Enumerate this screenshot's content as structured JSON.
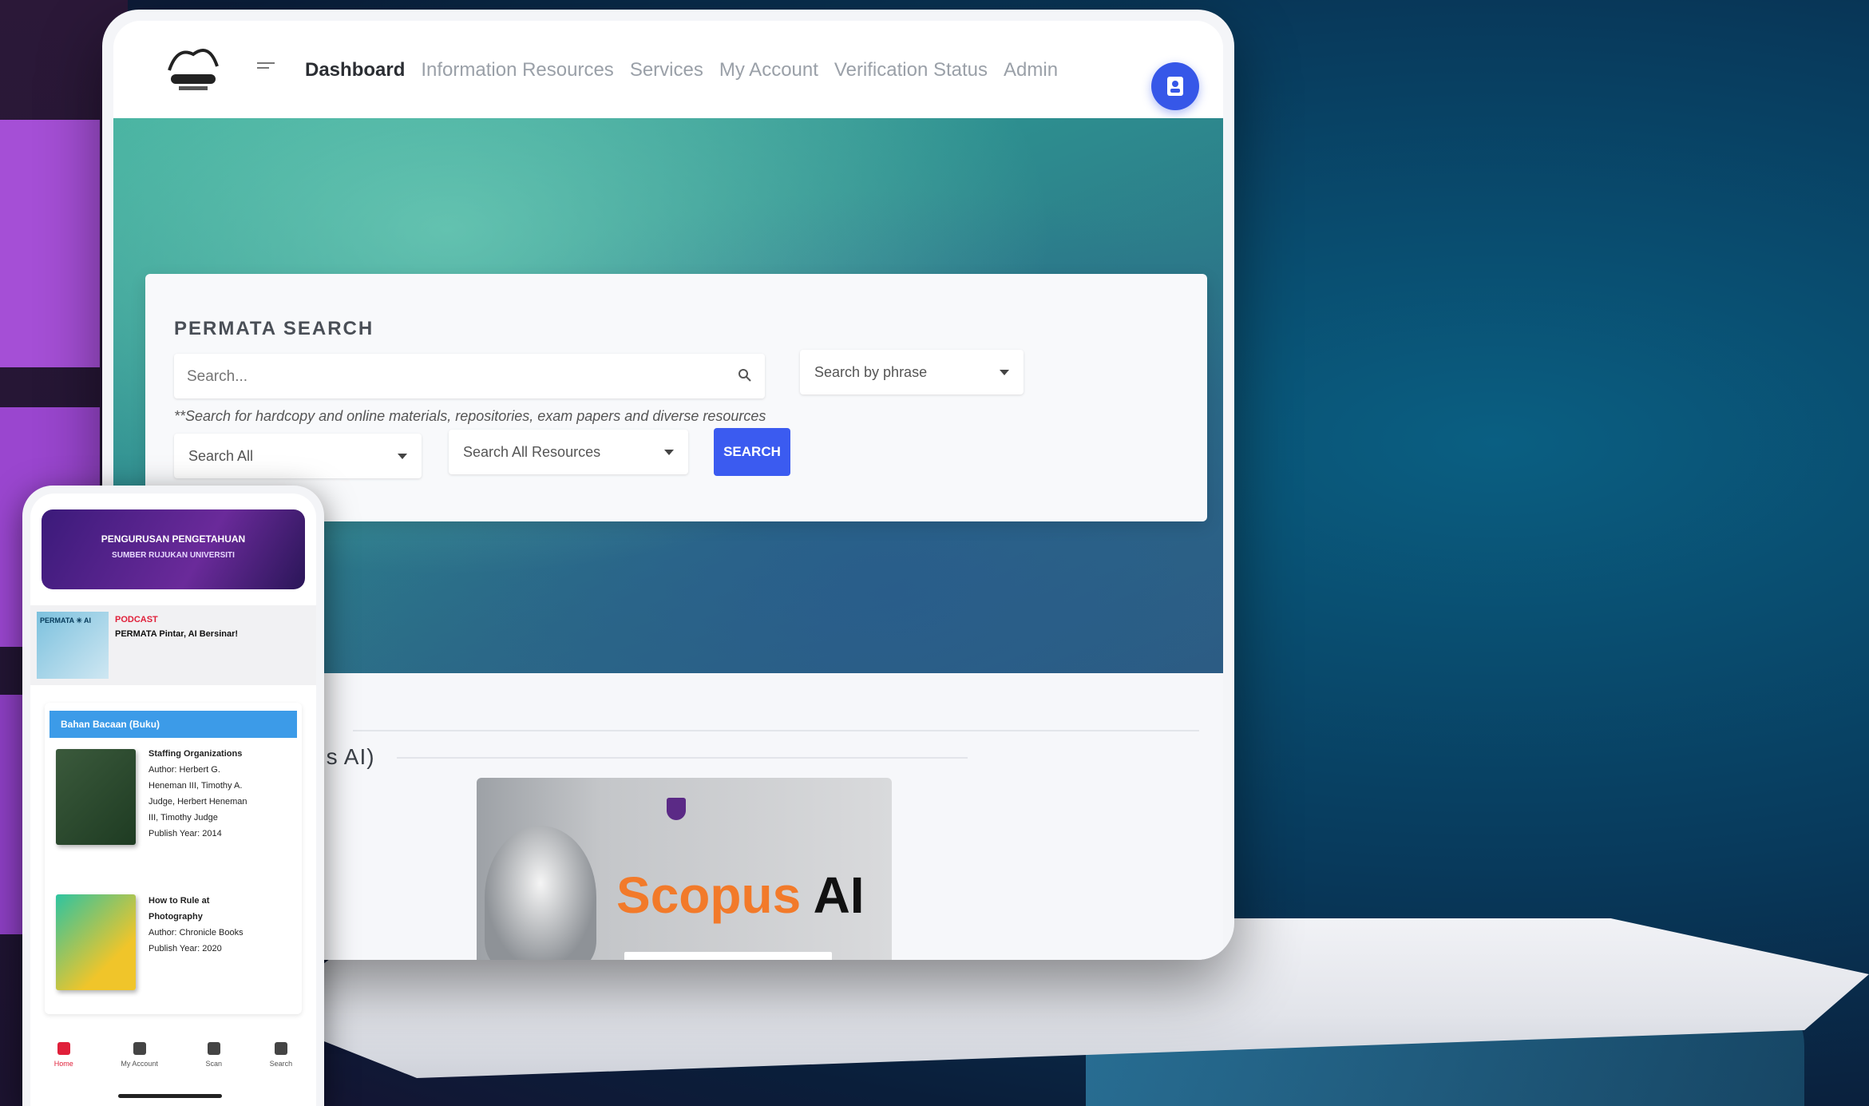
{
  "nav": {
    "items": [
      {
        "label": "Dashboard",
        "active": true
      },
      {
        "label": "Information Resources",
        "active": false
      },
      {
        "label": "Services",
        "active": false
      },
      {
        "label": "My Account",
        "active": false
      },
      {
        "label": "Verification Status",
        "active": false
      },
      {
        "label": "Admin",
        "active": false
      }
    ]
  },
  "search": {
    "title": "PERMATA SEARCH",
    "placeholder": "Search...",
    "mode_value": "Search by phrase",
    "hint": "**Search for hardcopy and online materials, repositories, exam papers and diverse resources",
    "scope_value": "Search All",
    "resources_value": "Search All Resources",
    "button_label": "SEARCH"
  },
  "section": {
    "title": "us AI)"
  },
  "promo": {
    "word": "Scopus",
    "ai": "AI"
  },
  "phone": {
    "banner_line1": "PENGURUSAN PENGETAHUAN",
    "banner_line2": "SUMBER RUJUKAN UNIVERSITI",
    "podcast_thumb": "PERMATA ✳ AI",
    "podcast_label": "PODCAST",
    "podcast_title": "PERMATA Pintar, AI Bersinar!",
    "card_header": "Bahan Bacaan (Buku)",
    "books": [
      {
        "title": "Staffing Organizations",
        "author": "Author: Herbert G. Heneman III, Timothy A. Judge, Herbert Heneman III, Timothy Judge",
        "year": "Publish Year: 2014"
      },
      {
        "title": "How to Rule at Photography",
        "author": "Author: Chronicle Books",
        "year": "Publish Year: 2020"
      }
    ],
    "bottom_nav": [
      "Home",
      "My Account",
      "Scan",
      "Search"
    ]
  },
  "colors": {
    "accent": "#3b5bf0",
    "podcast_red": "#e0203a",
    "card_header": "#3c9be8"
  }
}
